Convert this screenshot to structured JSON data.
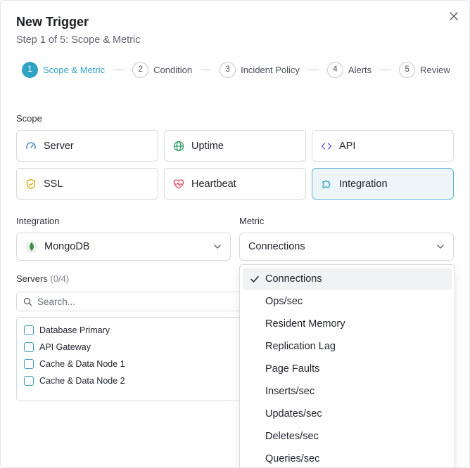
{
  "header": {
    "title": "New Trigger",
    "subtitle": "Step 1 of 5: Scope & Metric"
  },
  "stepper": {
    "steps": [
      {
        "num": "1",
        "label": "Scope & Metric",
        "active": true
      },
      {
        "num": "2",
        "label": "Condition",
        "active": false
      },
      {
        "num": "3",
        "label": "Incident Policy",
        "active": false
      },
      {
        "num": "4",
        "label": "Alerts",
        "active": false
      },
      {
        "num": "5",
        "label": "Review",
        "active": false
      }
    ]
  },
  "scope": {
    "label": "Scope",
    "options": [
      {
        "label": "Server",
        "icon": "gauge-icon"
      },
      {
        "label": "Uptime",
        "icon": "globe-icon"
      },
      {
        "label": "API",
        "icon": "code-icon"
      },
      {
        "label": "SSL",
        "icon": "shield-icon"
      },
      {
        "label": "Heartbeat",
        "icon": "heart-pulse-icon"
      },
      {
        "label": "Integration",
        "icon": "puzzle-icon"
      }
    ],
    "selected": "Integration"
  },
  "integration": {
    "label": "Integration",
    "value": "MongoDB",
    "icon": "mongodb-leaf-icon"
  },
  "metric": {
    "label": "Metric",
    "value": "Connections",
    "options": [
      "Connections",
      "Ops/sec",
      "Resident Memory",
      "Replication Lag",
      "Page Faults",
      "Inserts/sec",
      "Updates/sec",
      "Deletes/sec",
      "Queries/sec"
    ]
  },
  "servers": {
    "label": "Servers",
    "count": "(0/4)",
    "search_placeholder": "Search...",
    "items": [
      "Database Primary",
      "API Gateway",
      "Cache & Data Node 1",
      "Cache & Data Node 2"
    ]
  },
  "colors": {
    "accent": "#2fa3c4",
    "selected_card_bg": "#edf5f8",
    "border": "#d7dade"
  }
}
